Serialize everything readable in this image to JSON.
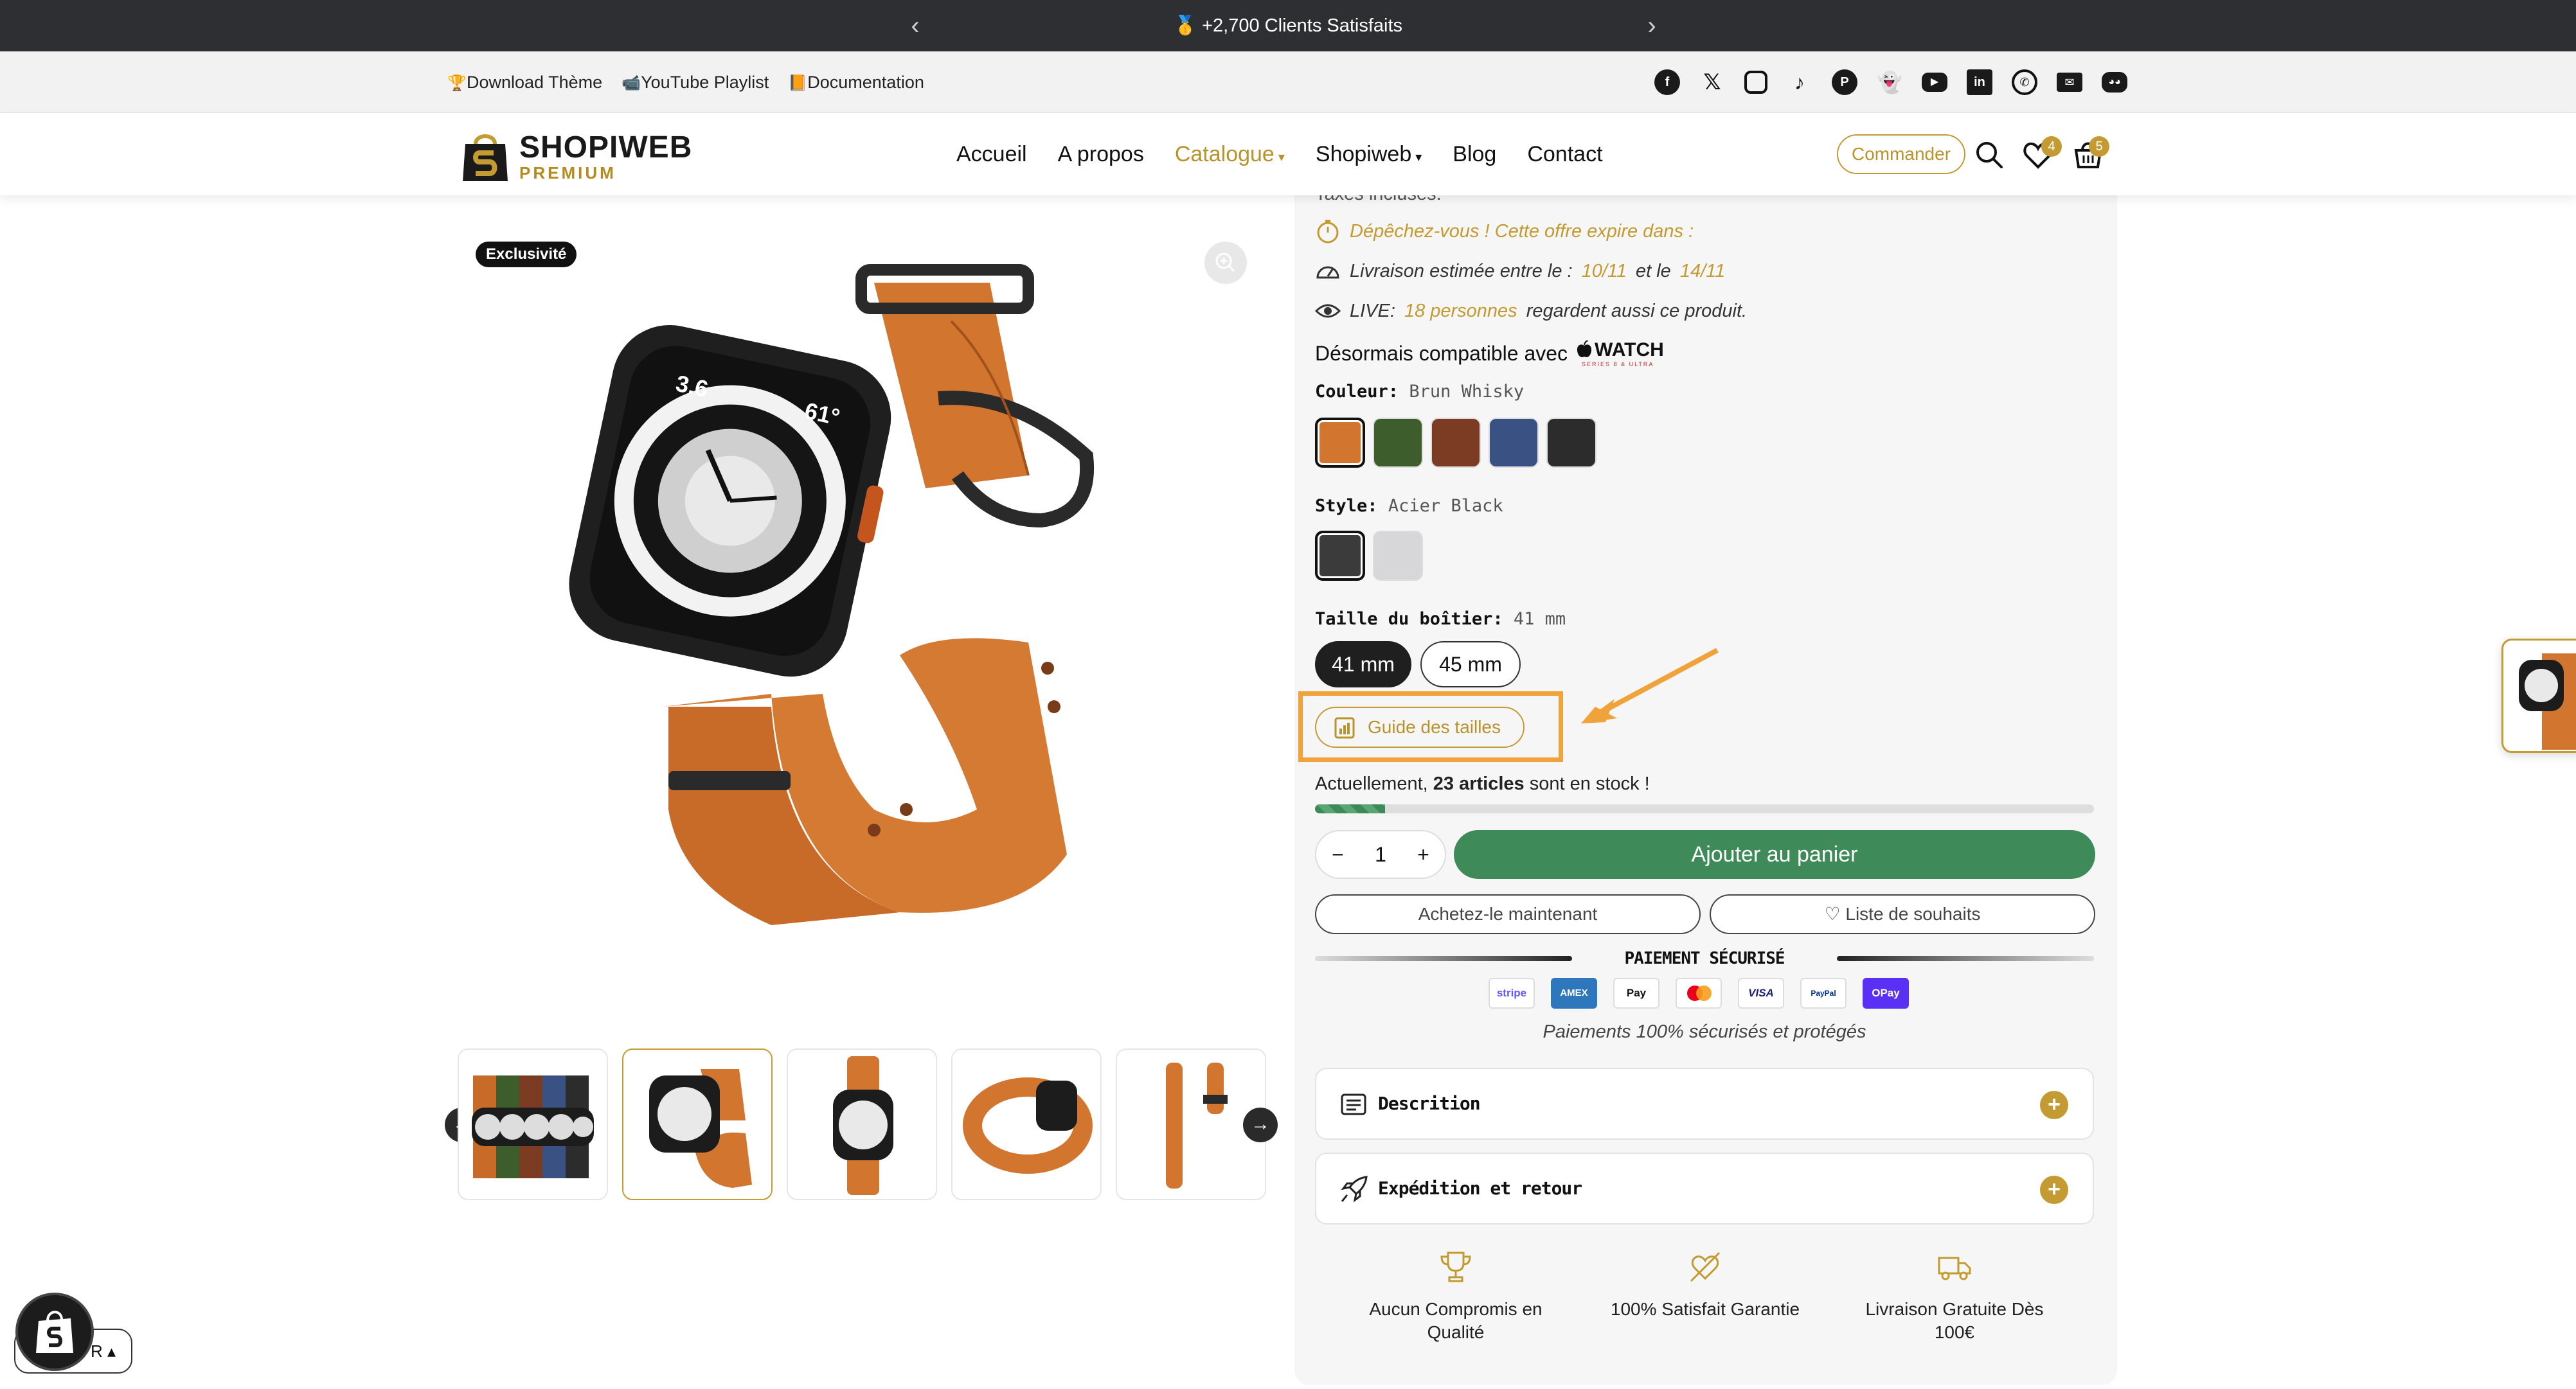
{
  "announcement": {
    "text": "🥇 +2,700 Clients Satisfaits",
    "prev": "‹",
    "next": "›"
  },
  "utility_links": [
    {
      "icon": "🏆",
      "label": "Download Thème"
    },
    {
      "icon": "📹",
      "label": "YouTube Playlist"
    },
    {
      "icon": "📙",
      "label": "Documentation"
    }
  ],
  "social_icons": [
    "facebook-icon",
    "x-icon",
    "instagram-icon",
    "tiktok-icon",
    "pinterest-icon",
    "snapchat-icon",
    "youtube-icon",
    "linkedin-icon",
    "whatsapp-icon",
    "email-icon",
    "discord-icon"
  ],
  "logo": {
    "name": "SHOPIWEB",
    "tagline": "PREMIUM"
  },
  "nav": [
    {
      "label": "Accueil"
    },
    {
      "label": "A propos"
    },
    {
      "label": "Catalogue",
      "caret": "▾",
      "active": true
    },
    {
      "label": "Shopiweb",
      "caret": "▾"
    },
    {
      "label": "Blog"
    },
    {
      "label": "Contact"
    }
  ],
  "header": {
    "order_button": "Commander",
    "wishlist_count": "4",
    "cart_count": "5"
  },
  "gallery": {
    "badge": "Exclusivité"
  },
  "product": {
    "taxes": "Taxes incluses.",
    "hurry": "Dépêchez-vous ! Cette offre expire dans :",
    "delivery_prefix": "Livraison estimée entre le :",
    "delivery_from": "10/11",
    "delivery_mid": "et le",
    "delivery_to": "14/11",
    "live_prefix": "LIVE:",
    "live_people": "18 personnes",
    "live_suffix": "regardent aussi ce produit.",
    "compat_text": "Désormais compatible avec",
    "compat_brand": "WATCH",
    "compat_series": "SERIES 8 & ULTRA",
    "color_label": "Couleur:",
    "color_value": "Brun Whisky",
    "style_label": "Style:",
    "style_value": "Acier Black",
    "size_label": "Taille du boîtier:",
    "size_value": "41 mm",
    "sizes": [
      "41 mm",
      "45 mm"
    ],
    "size_guide": "Guide des tailles",
    "stock_prefix": "Actuellement,",
    "stock_count": "23 articles",
    "stock_suffix": "sont en stock !",
    "stock_level": 0.09,
    "quantity": "1",
    "add_to_cart": "Ajouter au panier",
    "buy_now": "Achetez-le maintenant",
    "wishlist": "♡ Liste de souhaits",
    "secure_title": "PAIEMENT SÉCURISÉ",
    "payments": [
      "stripe",
      "AMEX",
      "Pay",
      "MC",
      "VISA",
      "PayPal",
      "OPay"
    ],
    "payment_note": "Paiements 100% sécurisés et protégés",
    "accordions": [
      "Descrition",
      "Expédition et retour"
    ],
    "features": [
      "Aucun Compromis en Qualité",
      "100% Satisfait Garantie",
      "Livraison Gratuite Dès 100€"
    ]
  },
  "colors": {
    "swatches": [
      "#d2752f",
      "#3d5e2c",
      "#7b3c23",
      "#3a5283",
      "#2c2c2c"
    ],
    "styles": [
      "#3b3b3b",
      "#d7d7d9"
    ],
    "accent": "#c49a33",
    "cta": "#3f8a59"
  },
  "currency": {
    "label": "R ▴"
  }
}
